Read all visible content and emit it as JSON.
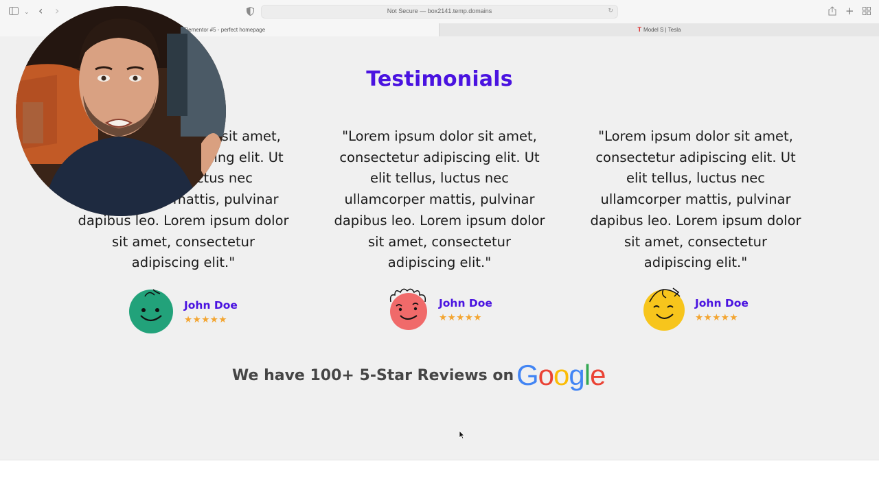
{
  "browser": {
    "address": "Not Secure — box2141.temp.domains",
    "tabs": [
      {
        "label": "Elementor #5 - perfect homepage"
      },
      {
        "label": "Model S | Tesla"
      }
    ]
  },
  "section": {
    "title": "Testimonials"
  },
  "testimonials": [
    {
      "quote": "\"Lorem ipsum dolor sit amet, consectetur adipiscing elit. Ut elit tellus, luctus nec ullamcorper mattis, pulvinar dapibus leo. Lorem ipsum dolor sit amet, consectetur adipiscing elit.\"",
      "name": "John Doe",
      "stars": "★★★★★",
      "rating": 5,
      "avatar_color": "#22a27a",
      "avatar_icon": "smiley-green-icon"
    },
    {
      "quote": "\"Lorem ipsum dolor sit amet, consectetur adipiscing elit. Ut elit tellus, luctus nec ullamcorper mattis, pulvinar dapibus leo. Lorem ipsum dolor sit amet, consectetur adipiscing elit.\"",
      "name": "John Doe",
      "stars": "★★★★★",
      "rating": 5,
      "avatar_color": "#f06a6a",
      "avatar_icon": "smiley-curly-red-icon"
    },
    {
      "quote": "\"Lorem ipsum dolor sit amet, consectetur adipiscing elit. Ut elit tellus, luctus nec ullamcorper mattis, pulvinar dapibus leo. Lorem ipsum dolor sit amet, consectetur adipiscing elit.\"",
      "name": "John Doe",
      "stars": "★★★★★",
      "rating": 5,
      "avatar_color": "#f7c51c",
      "avatar_icon": "smiley-yellow-icon"
    }
  ],
  "reviews": {
    "text": "We have 100+ 5-Star Reviews on",
    "google_letters": [
      "G",
      "o",
      "o",
      "g",
      "l",
      "e"
    ],
    "google_colors": [
      "#4285F4",
      "#EA4335",
      "#FBBC05",
      "#4285F4",
      "#34A853",
      "#EA4335"
    ]
  },
  "colors": {
    "accent": "#4a13e0",
    "star": "#f3a531",
    "page_bg": "#f0f0f0"
  }
}
